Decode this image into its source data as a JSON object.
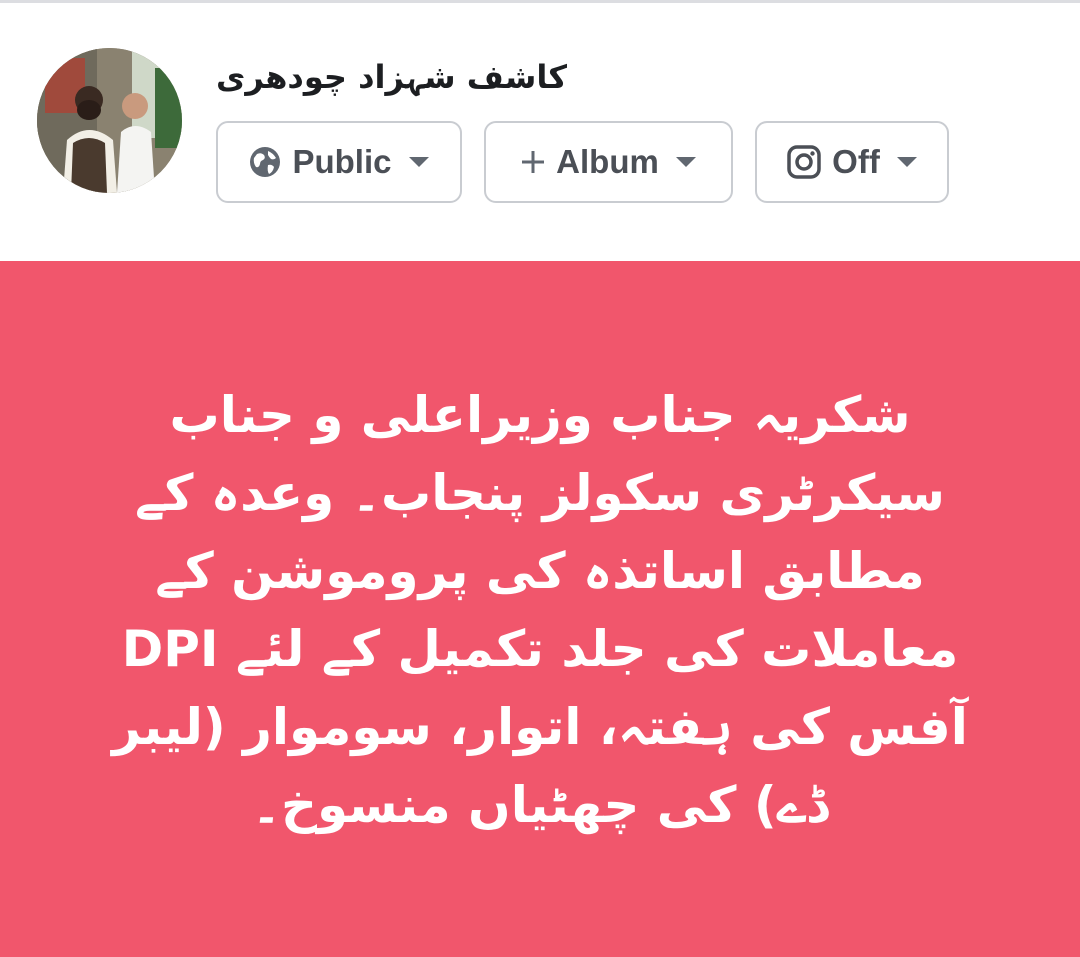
{
  "composer": {
    "author_name": "کاشف شہزاد چودھری",
    "avatar_icon": "profile-photo",
    "privacy": {
      "label": "Public",
      "icon": "globe-icon"
    },
    "album": {
      "label": "Album",
      "icon": "plus-icon"
    },
    "instagram": {
      "label": "Off",
      "icon": "instagram-icon"
    }
  },
  "post": {
    "background_color": "#f1566c",
    "text_color": "#ffffff",
    "lines": [
      "شکریہ جناب وزیراعلی و جناب",
      "سیکرٹری سکولز پنجاب۔ وعدہ کے",
      "مطابق اساتذہ کی پروموشن کے",
      "معاملات کی جلد تکمیل کے لئے DPI",
      "آفس کی ہفتہ، اتوار، سوموار (لیبر",
      "ڈے) کی چھٹیاں منسوخ۔"
    ]
  }
}
